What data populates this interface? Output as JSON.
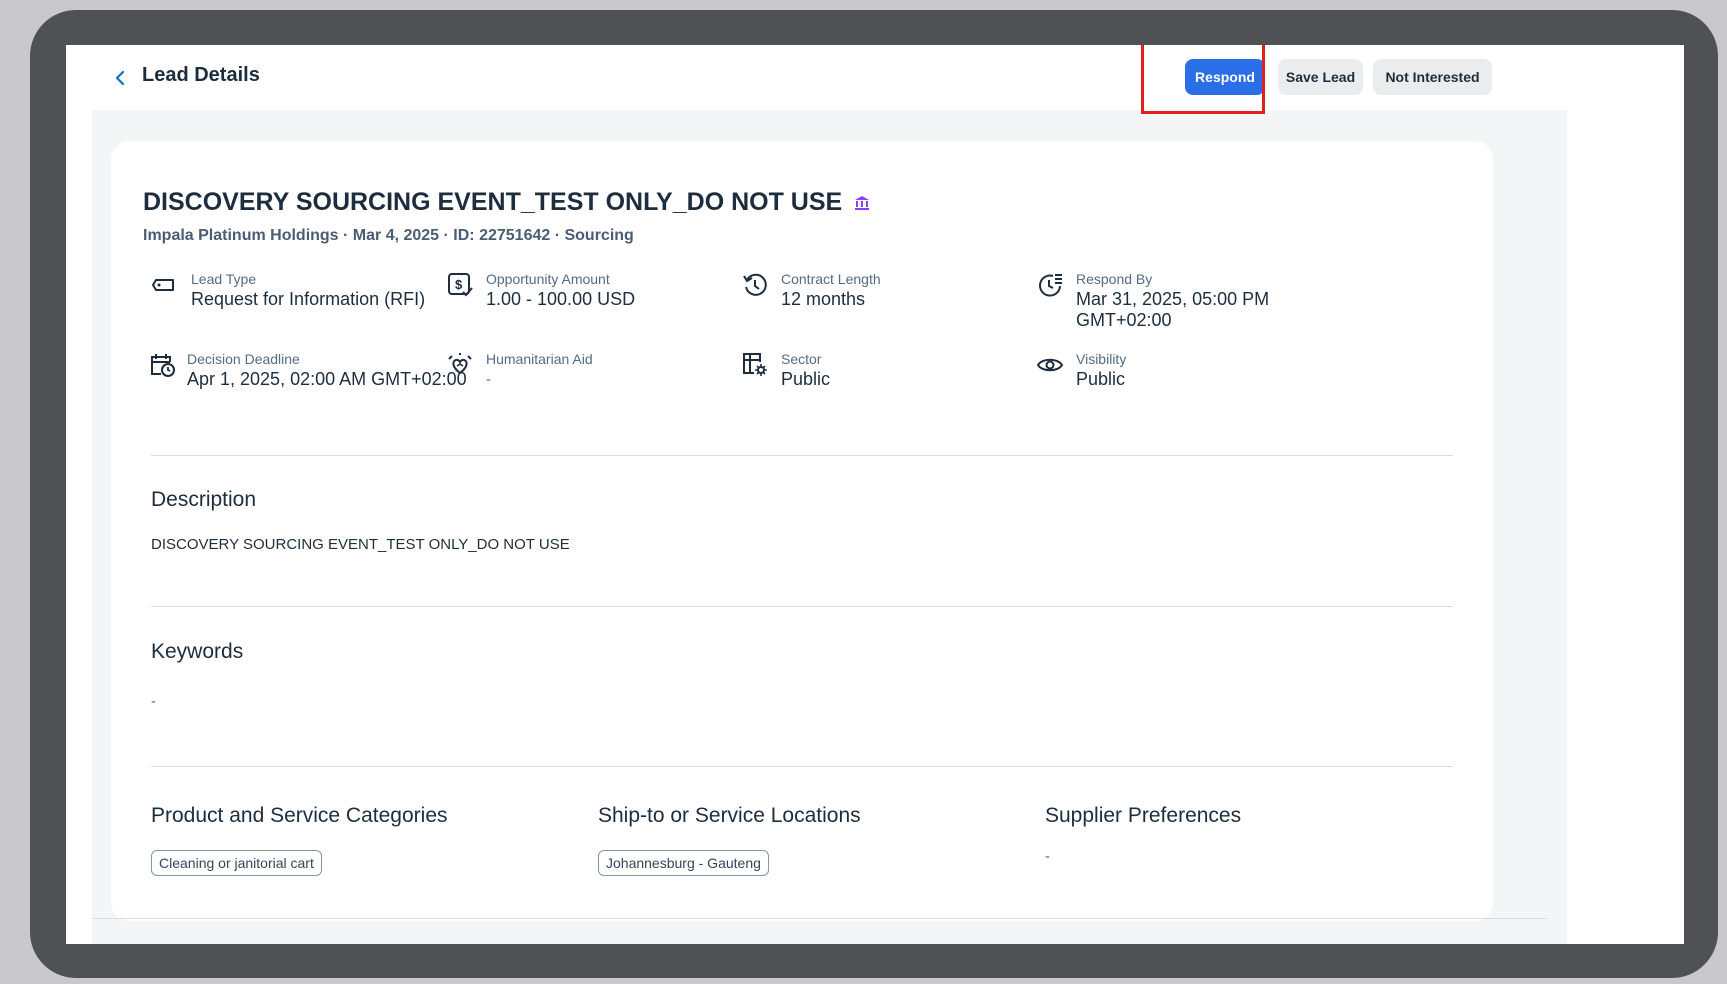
{
  "header": {
    "back_icon": "chevron-left-icon",
    "title": "Lead Details",
    "respond_label": "Respond",
    "save_label": "Save Lead",
    "not_interested_label": "Not Interested"
  },
  "lead": {
    "title": "DISCOVERY SOURCING EVENT_TEST ONLY_DO NOT USE",
    "title_icon": "institution-icon",
    "subtitle": "Impala Platinum Holdings · Mar 4, 2025 · ID: 22751642 · Sourcing"
  },
  "fields": [
    {
      "label": "Lead Type",
      "value": "Request for Information (RFI)",
      "icon": "tag-icon"
    },
    {
      "label": "Opportunity Amount",
      "value": "1.00 - 100.00 USD",
      "icon": "money-icon"
    },
    {
      "label": "Contract Length",
      "value": "12 months",
      "icon": "history-icon"
    },
    {
      "label": "Respond By",
      "value": "Mar 31, 2025, 05:00 PM GMT+02:00",
      "icon": "clock-list-icon"
    },
    {
      "label": "Decision Deadline",
      "value": "Apr 1, 2025, 02:00 AM GMT+02:00",
      "icon": "calendar-clock-icon"
    },
    {
      "label": "Humanitarian Aid",
      "value": "-",
      "icon": "hand-heart-icon"
    },
    {
      "label": "Sector",
      "value": "Public",
      "icon": "building-gear-icon"
    },
    {
      "label": "Visibility",
      "value": "Public",
      "icon": "eye-icon"
    }
  ],
  "description": {
    "heading": "Description",
    "text": "DISCOVERY SOURCING EVENT_TEST ONLY_DO NOT USE"
  },
  "keywords": {
    "heading": "Keywords",
    "value": "-"
  },
  "categories": {
    "heading": "Product and Service Categories",
    "tags": [
      "Cleaning or janitorial cart"
    ]
  },
  "locations": {
    "heading": "Ship-to or Service Locations",
    "tags": [
      "Johannesburg - Gauteng"
    ]
  },
  "supplier_preferences": {
    "heading": "Supplier Preferences",
    "value": "-"
  },
  "colors": {
    "primary": "#2a6ee8",
    "highlight": "#e0201b",
    "title_icon": "#8a3ffc"
  }
}
